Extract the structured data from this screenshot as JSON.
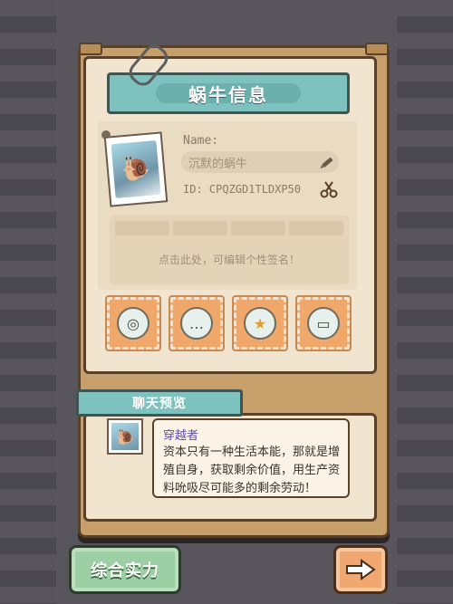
{
  "screen": {
    "title": "蜗牛信息"
  },
  "profile": {
    "name_label": "Name:",
    "name_value": "沉默的蜗牛",
    "id_text": "ID: CPQZGD1TLDXP50",
    "signature_hint": "点击此处，可编辑个性签名！"
  },
  "badges": [
    {
      "icon": "spiral-badge-icon"
    },
    {
      "icon": "chat-bubble-badge-icon"
    },
    {
      "icon": "star-medal-badge-icon"
    },
    {
      "icon": "ribbon-badge-icon"
    }
  ],
  "chat_preview": {
    "header": "聊天预览",
    "author": "穿越者",
    "message": "资本只有一种生活本能，那就是增殖自身，获取剩余价值，用生产资料吮吸尽可能多的剩余劳动！"
  },
  "footer": {
    "strength_button": "综合实力",
    "next_icon": "right-arrow-icon"
  },
  "colors": {
    "accent_teal": "#7ec2bf",
    "frame_brown": "#5a4029",
    "panel_cream": "#f1e5cf",
    "button_green": "#9ccfa4",
    "button_orange": "#f1a870",
    "author_purple": "#5c4fa8"
  }
}
